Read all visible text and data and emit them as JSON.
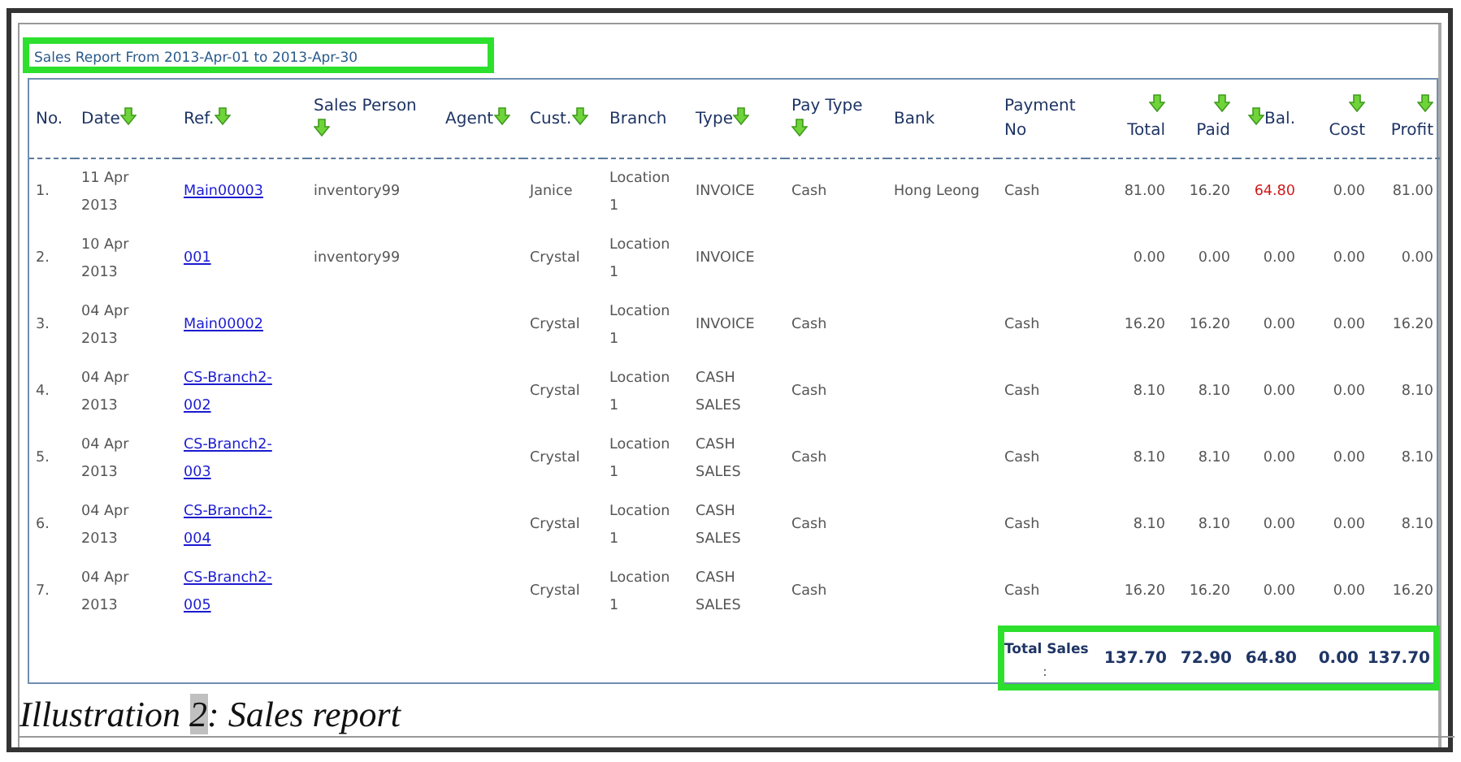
{
  "report": {
    "title": "Sales Report From 2013-Apr-01 to 2013-Apr-30",
    "title_highlighted": true
  },
  "columns": [
    {
      "label": "No.",
      "kind": "plain"
    },
    {
      "label": "Date",
      "kind": "sortafter"
    },
    {
      "label": "Ref.",
      "kind": "sortafter"
    },
    {
      "label": "Sales Person",
      "kind": "sortbelow"
    },
    {
      "label": "Agent",
      "kind": "sortafter"
    },
    {
      "label": "Cust.",
      "kind": "sortafter"
    },
    {
      "label": "Branch",
      "kind": "plain"
    },
    {
      "label": "Type",
      "kind": "sortafter"
    },
    {
      "label": "Pay Type",
      "kind": "sortbelow"
    },
    {
      "label": "Bank",
      "kind": "plain"
    },
    {
      "label": "Payment No",
      "kind": "plain"
    },
    {
      "label": "Total",
      "kind": "amountabove"
    },
    {
      "label": "Paid",
      "kind": "amountabove"
    },
    {
      "label": "Bal.",
      "kind": "amountbefore"
    },
    {
      "label": "Cost",
      "kind": "amountabove"
    },
    {
      "label": "Profit",
      "kind": "amountabove"
    }
  ],
  "rows": [
    {
      "cells": [
        "1.",
        "11 Apr 2013",
        "Main00003",
        "inventory99",
        "",
        "Janice",
        "Location 1",
        "INVOICE",
        "Cash",
        "Hong Leong",
        "Cash",
        "81.00",
        "16.20",
        "64.80",
        "0.00",
        "81.00"
      ],
      "bal_alert": true
    },
    {
      "cells": [
        "2.",
        "10 Apr 2013",
        "001",
        "inventory99",
        "",
        "Crystal",
        "Location 1",
        "INVOICE",
        "",
        "",
        "",
        "0.00",
        "0.00",
        "0.00",
        "0.00",
        "0.00"
      ],
      "bal_alert": false
    },
    {
      "cells": [
        "3.",
        "04 Apr 2013",
        "Main00002",
        "",
        "",
        "Crystal",
        "Location 1",
        "INVOICE",
        "Cash",
        "",
        "Cash",
        "16.20",
        "16.20",
        "0.00",
        "0.00",
        "16.20"
      ],
      "bal_alert": false
    },
    {
      "cells": [
        "4.",
        "04 Apr 2013",
        "CS-Branch2-002",
        "",
        "",
        "Crystal",
        "Location 1",
        "CASH SALES",
        "Cash",
        "",
        "Cash",
        "8.10",
        "8.10",
        "0.00",
        "0.00",
        "8.10"
      ],
      "bal_alert": false
    },
    {
      "cells": [
        "5.",
        "04 Apr 2013",
        "CS-Branch2-003",
        "",
        "",
        "Crystal",
        "Location 1",
        "CASH SALES",
        "Cash",
        "",
        "Cash",
        "8.10",
        "8.10",
        "0.00",
        "0.00",
        "8.10"
      ],
      "bal_alert": false
    },
    {
      "cells": [
        "6.",
        "04 Apr 2013",
        "CS-Branch2-004",
        "",
        "",
        "Crystal",
        "Location 1",
        "CASH SALES",
        "Cash",
        "",
        "Cash",
        "8.10",
        "8.10",
        "0.00",
        "0.00",
        "8.10"
      ],
      "bal_alert": false
    },
    {
      "cells": [
        "7.",
        "04 Apr 2013",
        "CS-Branch2-005",
        "",
        "",
        "Crystal",
        "Location 1",
        "CASH SALES",
        "Cash",
        "",
        "Cash",
        "16.20",
        "16.20",
        "0.00",
        "0.00",
        "16.20"
      ],
      "bal_alert": false
    }
  ],
  "totals": {
    "label": "Total Sales",
    "separator": ":",
    "values": [
      "137.70",
      "72.90",
      "64.80",
      "0.00",
      "137.70"
    ],
    "highlighted": true
  },
  "caption": {
    "prefix": "Illustration",
    "number": "2",
    "suffix": ": Sales report",
    "number_highlighted": true
  }
}
